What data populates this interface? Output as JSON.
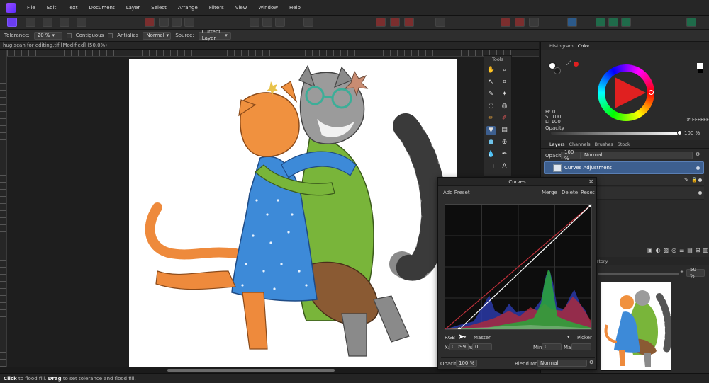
{
  "menu": [
    "File",
    "Edit",
    "Text",
    "Document",
    "Layer",
    "Select",
    "Arrange",
    "Filters",
    "View",
    "Window",
    "Help"
  ],
  "context": {
    "tolerance_label": "Tolerance:",
    "tolerance_value": "20 %",
    "contiguous_label": "Contiguous",
    "antialias_label": "Antialias",
    "blend_value": "Normal",
    "source_label": "Source:",
    "source_value": "Current Layer"
  },
  "document_tab": "hug scan for editing.tif [Modified] (50.0%)",
  "tools_title": "Tools",
  "studio": {
    "histogram_tab": "Histogram",
    "color_tab": "Color",
    "h_readout": "H: 0",
    "s_readout": "S: 100",
    "l_readout": "L: 100",
    "hex_value": "FFFFFF",
    "opacity_label": "Opacity",
    "opacity_value": "100 %",
    "layers_tab": "Layers",
    "channels_tab": "Channels",
    "brushes_tab": "Brushes",
    "stock_tab": "Stock",
    "layers_opacity_label": "Opacity:",
    "layers_opacity_value": "100 %",
    "layers_blend_value": "Normal",
    "layer_name": "Curves Adjustment",
    "history_tab": "story",
    "zoom_value": "50 %"
  },
  "curves": {
    "title": "Curves",
    "add_preset": "Add Preset",
    "merge": "Merge",
    "delete": "Delete",
    "reset": "Reset",
    "channel_space": "RGB",
    "channel": "Master",
    "picker": "Picker",
    "x_label": "X:",
    "x_value": "0.099",
    "y_label": "Y:",
    "y_value": "0",
    "min_label": "Min:",
    "min_value": "0",
    "max_label": "Max:",
    "max_value": "1",
    "opacity_label": "Opacity:",
    "opacity_value": "100 %",
    "blend_label": "Blend Mode:",
    "blend_value": "Normal"
  },
  "status": {
    "click_word": "Click",
    "click_text": " to flood fill. ",
    "drag_word": "Drag",
    "drag_text": " to set tolerance and flood fill."
  },
  "colors": {
    "accent": "#6a3df0",
    "selection": "#3d5f8f",
    "curve_line": "#ffffff",
    "reference_line": "#c0303a"
  }
}
